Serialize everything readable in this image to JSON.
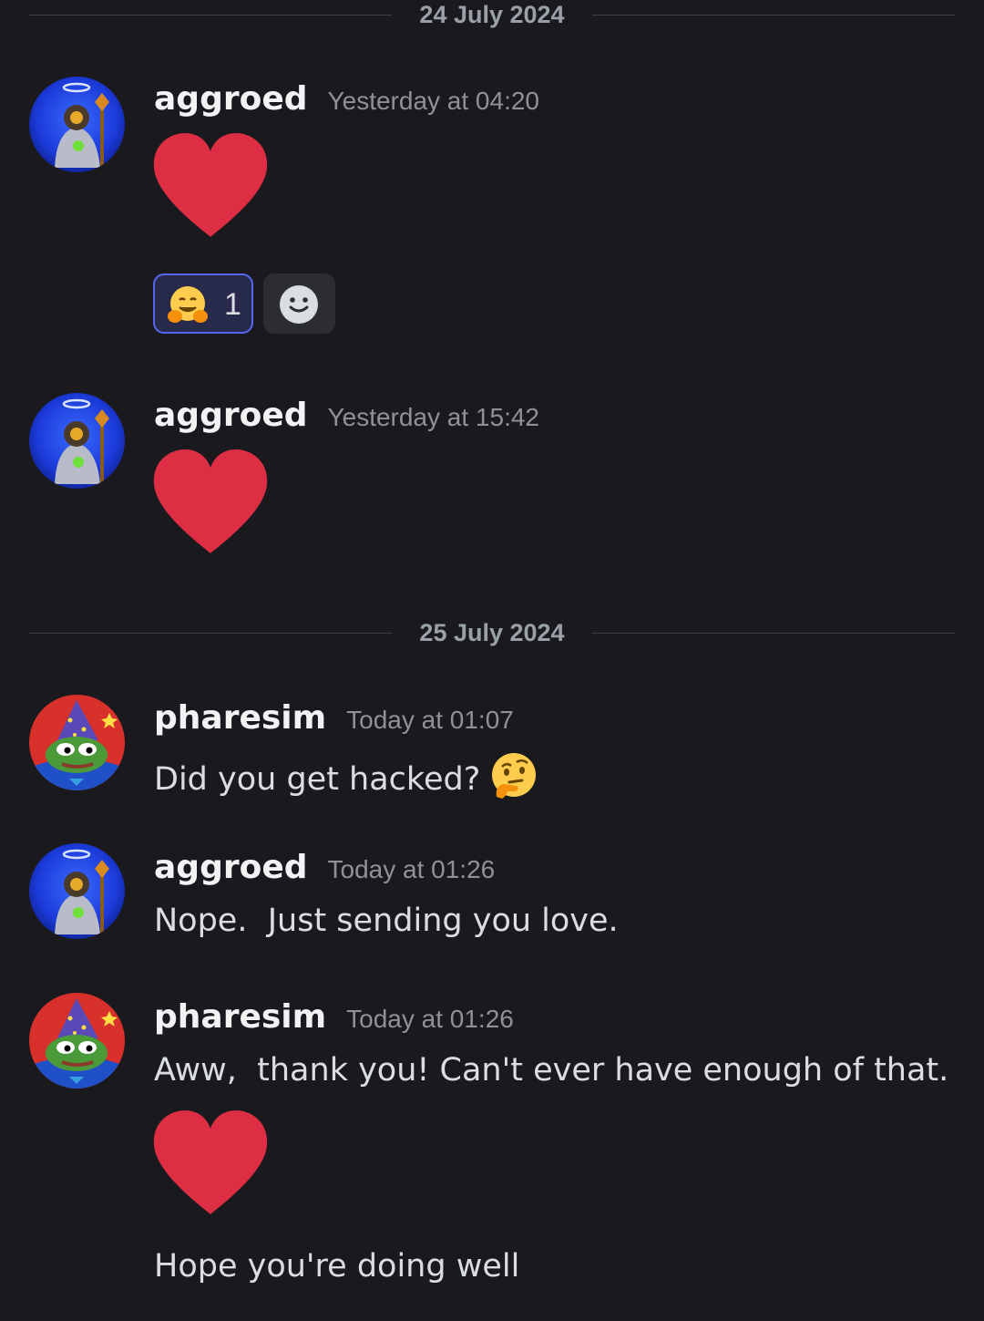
{
  "dividers": [
    "24 July 2024",
    "25 July 2024"
  ],
  "messages": [
    {
      "username": "aggroed",
      "timestamp": "Yesterday at 04:20",
      "content": "heart emoji",
      "reactions": [
        {
          "emoji": "hugging-face",
          "count": "1"
        }
      ]
    },
    {
      "username": "aggroed",
      "timestamp": "Yesterday at 15:42",
      "content": "heart emoji"
    },
    {
      "username": "pharesim",
      "timestamp": "Today at 01:07",
      "text": "Did you get hacked?",
      "emoji": "thinking-face"
    },
    {
      "username": "aggroed",
      "timestamp": "Today at 01:26",
      "text": "Nope.  Just sending you love."
    },
    {
      "username": "pharesim",
      "timestamp": "Today at 01:26",
      "text": "Aww,  thank you! Can't ever have enough of that.",
      "text2": "Hope you're doing well"
    }
  ],
  "colors": {
    "background": "#1a1a1e",
    "heart": "#dd2e44",
    "reaction_active_border": "#5865f2",
    "reaction_active_bg": "#272a4a"
  }
}
